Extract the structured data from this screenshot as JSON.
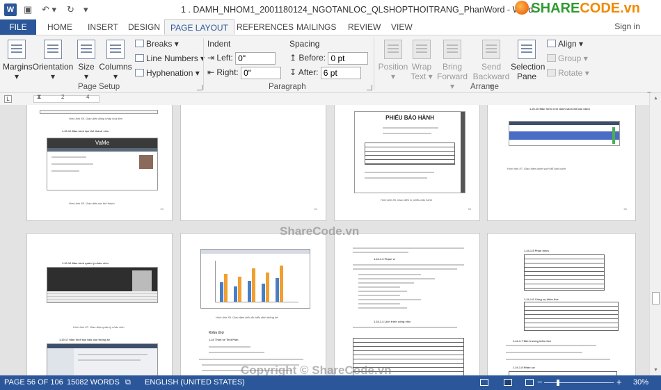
{
  "titlebar": {
    "app_icon": "W",
    "title": "1 . DAMH_NHOM1_2001180124_NGOTANLOC_QLSHOPTHOITRANG_PhanWord - Word",
    "logo_part1": "SHARE",
    "logo_part2": "CODE.vn",
    "save_icon": "save-icon",
    "undo_icon": "undo-icon",
    "redo_icon": "redo-icon"
  },
  "tabs": {
    "file": "FILE",
    "home": "HOME",
    "insert": "INSERT",
    "design": "DESIGN",
    "page_layout": "PAGE LAYOUT",
    "references": "REFERENCES",
    "mailings": "MAILINGS",
    "review": "REVIEW",
    "view": "VIEW",
    "sign_in": "Sign in"
  },
  "ribbon": {
    "page_setup": {
      "margins": "Margins",
      "orientation": "Orientation",
      "size": "Size",
      "columns": "Columns",
      "breaks": "Breaks",
      "line_numbers": "Line Numbers",
      "hyphenation": "Hyphenation",
      "label": "Page Setup"
    },
    "paragraph": {
      "indent": "Indent",
      "left_label": "Left:",
      "left_value": "0\"",
      "right_label": "Right:",
      "right_value": "0\"",
      "spacing": "Spacing",
      "before_label": "Before:",
      "before_value": "0 pt",
      "after_label": "After:",
      "after_value": "6 pt",
      "label": "Paragraph"
    },
    "arrange": {
      "position": "Position",
      "wrap_text_1": "Wrap",
      "wrap_text_2": "Text",
      "bring_forward_1": "Bring",
      "bring_forward_2": "Forward",
      "send_backward_1": "Send",
      "send_backward_2": "Backward",
      "selection_pane_1": "Selection",
      "selection_pane_2": "Pane",
      "align": "Align",
      "group": "Group",
      "rotate": "Rotate",
      "label": "Arrange"
    }
  },
  "ruler": {
    "marks": [
      "2",
      "4"
    ]
  },
  "document": {
    "p1_caption": "Hình ảnh 85. Giao diện đăng nhập hóa đơn",
    "p1_heading": "1.20.12 Màn hình tạo thể thành viên",
    "p1_app": "VaMe",
    "p1_caption2": "Hình ảnh 85. Giao diện tạo thẻ thành",
    "p3_title": "PHIẾU BẢO HÀNH",
    "p3_caption": "Hình ảnh 86. Giao diện in phiếu bảo hành",
    "p4_heading": "1.20.16 Màn hình xem danh sách đổ bảo hành",
    "p4_caption": "Hình ảnh 87. Giao diện danh sách đổ bảo hành",
    "p5_heading": "1.20.16 Màn hình quản lý nhân viên",
    "p5_caption": "Hình ảnh 87. Giao diện quản lý nhân viên",
    "p5_heading2": "1.20.17 Màn hình tạo bảo cáo thống kê",
    "p6_caption": "Hình ảnh 89. Giao diện biểu đồ biểu diện thống kê",
    "p6_heading": "Kiểm thử",
    "p6_sub": "1.24 Thiết kế Test Plan",
    "p7_heading": "1.24.1.3 Phạm vi",
    "p7_heading2": "1.24.1.4 Lịch trình công việc",
    "p8_heading": "1.24.1.5 Phần mềm",
    "p8_heading2": "1.24.1.6 Công cụ kiểm thử",
    "p8_heading3": "1.24.1.7 Môi trường kiểm thử",
    "p8_heading4": "1.24.1.8 Nhân sự",
    "page_numbers": [
      "53",
      "54",
      "55",
      "56"
    ]
  },
  "watermarks": {
    "center": "ShareCode.vn",
    "bottom": "Copyright © ShareCode.vn"
  },
  "status": {
    "page": "PAGE 56 OF 106",
    "words": "15082 WORDS",
    "language": "ENGLISH (UNITED STATES)",
    "zoom": "30%",
    "zoom_out": "−",
    "zoom_in": "+"
  },
  "colors": {
    "accent": "#2b579a",
    "logo_green": "#2f9a2f",
    "logo_orange": "#f08a00"
  }
}
